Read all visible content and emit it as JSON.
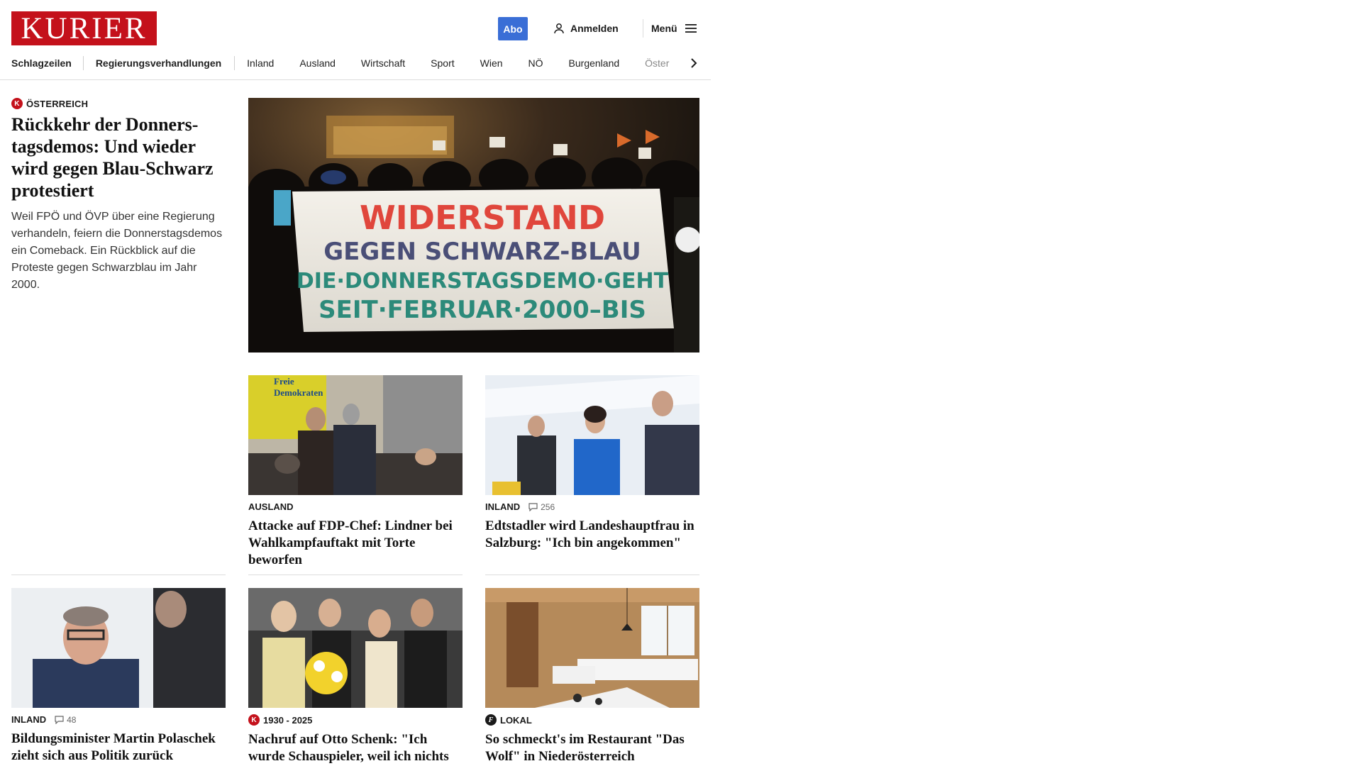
{
  "header": {
    "logo_text": "KURIER",
    "abo_label": "Abo",
    "login_label": "Anmelden",
    "menu_label": "Menü",
    "brand_color": "#c4111b",
    "accent_color": "#3a6ed6"
  },
  "nav": {
    "items": [
      "Schlagzeilen",
      "Regierungsverhandlungen",
      "Inland",
      "Ausland",
      "Wirtschaft",
      "Sport",
      "Wien",
      "NÖ",
      "Burgenland",
      "Öster"
    ]
  },
  "lead": {
    "category": "ÖSTERREICH",
    "badge": "K",
    "title": "Rückkehr der Donners­tagsdemos: Und wieder wird gegen Blau-Schwarz protestiert",
    "teaser": "Weil FPÖ und ÖVP über eine Regierung verhandeln, feiern die Donnerstagsdemos ein Comeback. Ein Rückblick auf die Proteste gegen Schwarzblau im Jahr 2000.",
    "banner_line1": "WIDERSTAND",
    "banner_line2": "GEGEN SCHWARZ-BLAU",
    "banner_line3": "DIE·DONNERSTAGSDEMO·GEHT",
    "banner_line4": "SEIT·FEBRUAR·2000–BIS"
  },
  "cards": [
    {
      "category": "AUSLAND",
      "comments": "",
      "title": "Attacke auf FDP-Chef: Lindner bei Wahlkampfauftakt mit Torte beworfen",
      "photo_text1": "Freie",
      "photo_text2": "Demokraten"
    },
    {
      "category": "INLAND",
      "comments": "256",
      "title": "Edtstadler wird Landeshauptfrau in Salzburg: \"Ich bin angekommen\""
    },
    {
      "category": "INLAND",
      "comments": "48",
      "title": "Bildungsminister Martin Pola­schek zieht sich aus Politik zurück"
    },
    {
      "category": "1930 - 2025",
      "badge": "K",
      "comments": "",
      "title": "Nachruf auf Otto Schenk: \"Ich wurde Schauspieler, weil ich nichts anderes kann\""
    },
    {
      "category": "LOKAL",
      "badge": "f",
      "comments": "",
      "title": "So schmeckt's im Restaurant \"Das Wolf\" in Niederösterreich"
    }
  ]
}
